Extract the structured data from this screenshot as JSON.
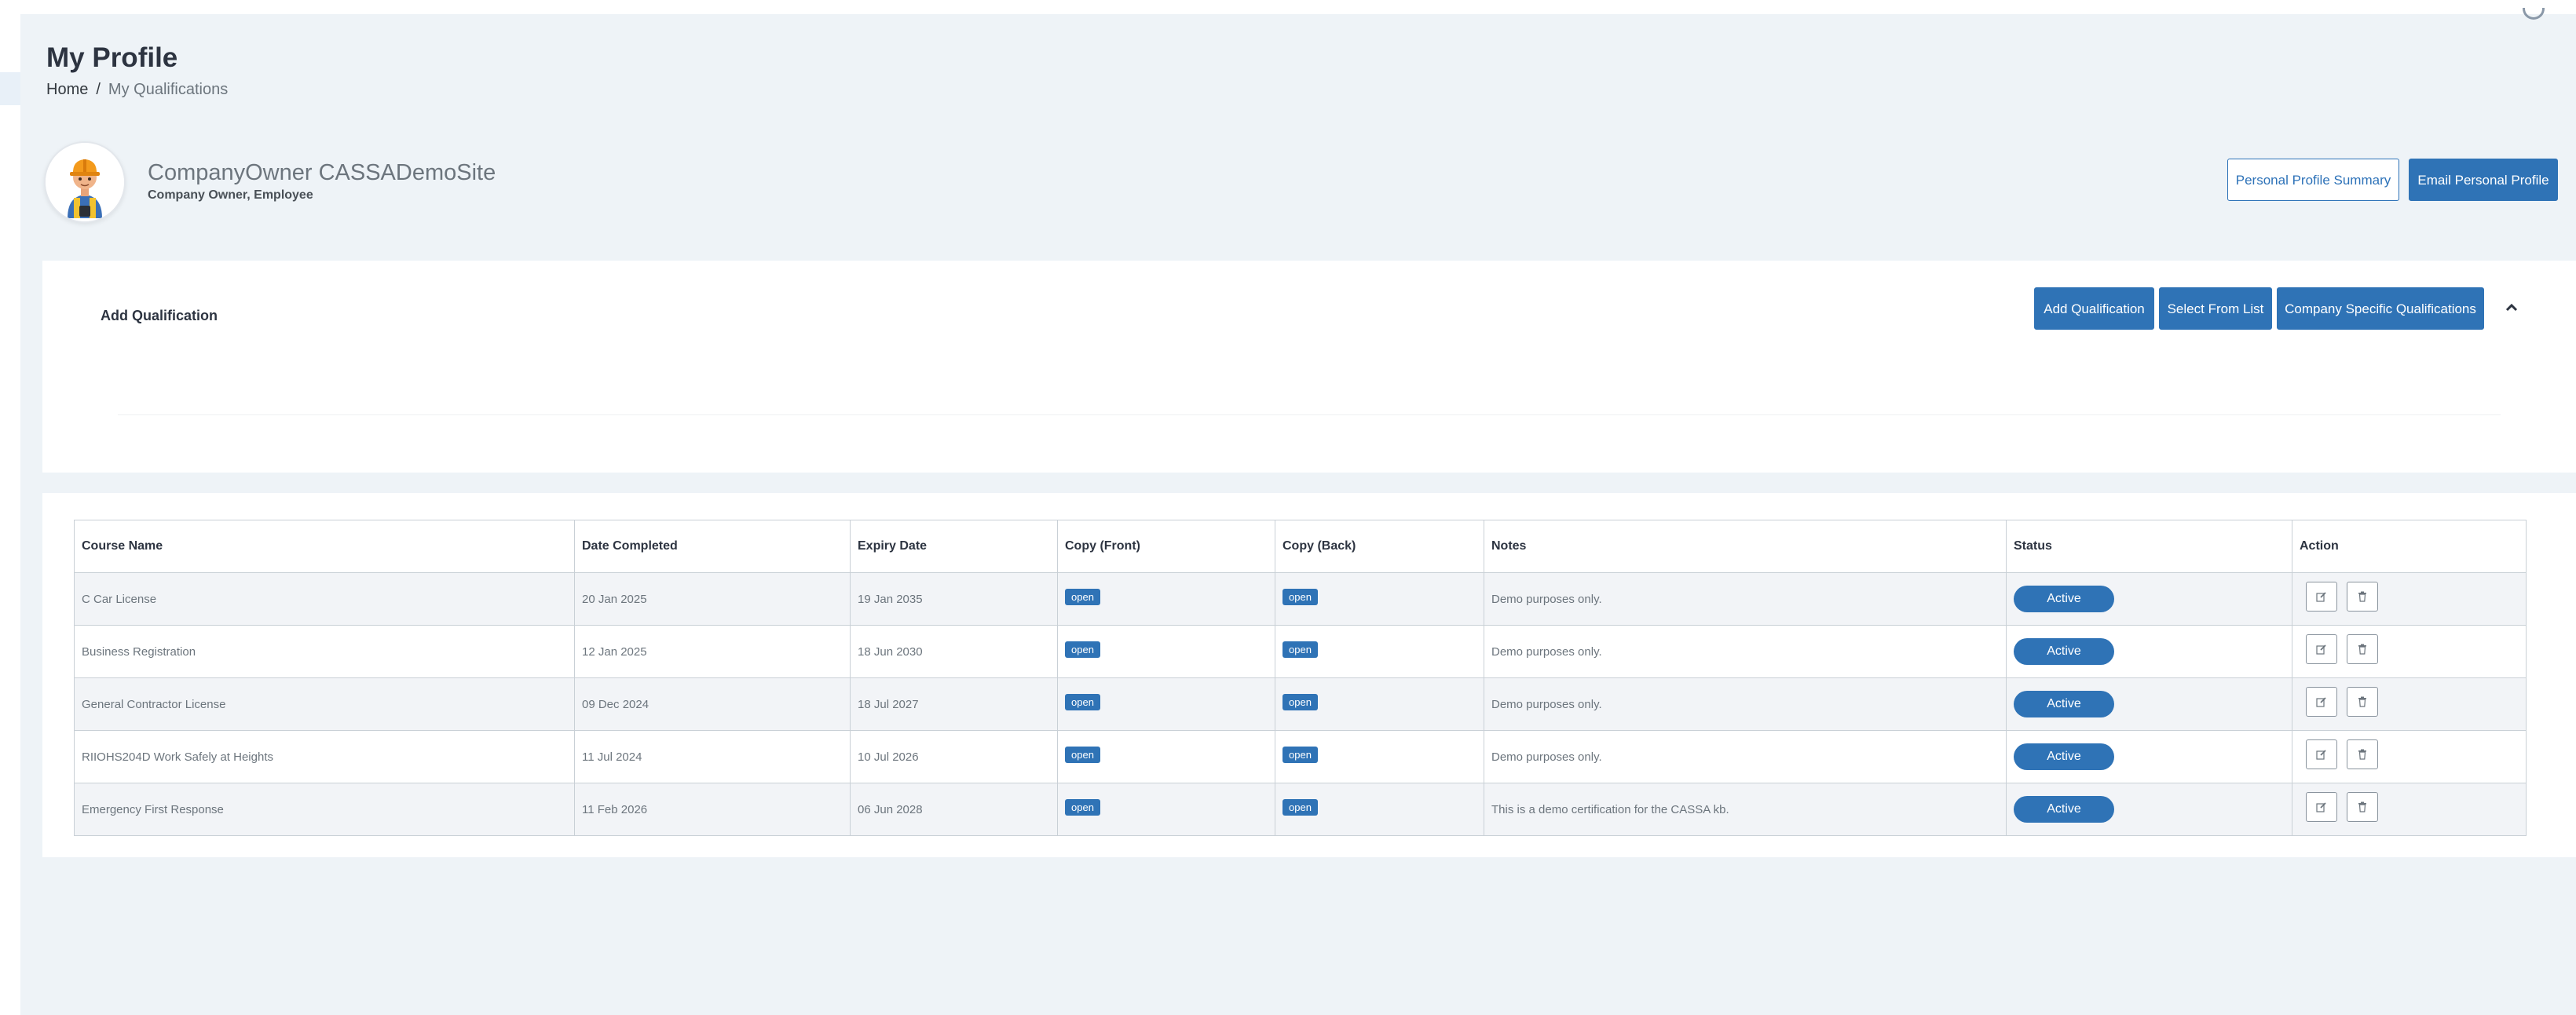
{
  "header": {
    "title": "My Profile",
    "breadcrumb": [
      "Home",
      "My Qualifications"
    ]
  },
  "profile": {
    "name": "CompanyOwner CASSADemoSite",
    "roles": "Company Owner, Employee",
    "summary_button": "Personal Profile Summary",
    "email_button": "Email Personal Profile"
  },
  "add_section": {
    "title": "Add Qualification",
    "add_button": "Add Qualification",
    "select_button": "Select From List",
    "company_button": "Company Specific Qualifications",
    "collapse_icon": "chevron-up-icon"
  },
  "table": {
    "columns": [
      "Course Name",
      "Date Completed",
      "Expiry Date",
      "Copy (Front)",
      "Copy (Back)",
      "Notes",
      "Status",
      "Action"
    ],
    "rows": [
      {
        "course": "C Car License",
        "completed": "20 Jan 2025",
        "expiry": "19 Jan 2035",
        "front": "open",
        "back": "open",
        "notes": "Demo purposes only.",
        "status": "Active"
      },
      {
        "course": "Business Registration",
        "completed": "12 Jan 2025",
        "expiry": "18 Jun 2030",
        "front": "open",
        "back": "open",
        "notes": "Demo purposes only.",
        "status": "Active"
      },
      {
        "course": "General Contractor License",
        "completed": "09 Dec 2024",
        "expiry": "18 Jul 2027",
        "front": "open",
        "back": "open",
        "notes": "Demo purposes only.",
        "status": "Active"
      },
      {
        "course": "RIIOHS204D Work Safely at Heights",
        "completed": "11 Jul 2024",
        "expiry": "10 Jul 2026",
        "front": "open",
        "back": "open",
        "notes": "Demo purposes only.",
        "status": "Active"
      },
      {
        "course": "Emergency First Response",
        "completed": "11 Feb 2026",
        "expiry": "06 Jun 2028",
        "front": "open",
        "back": "open",
        "notes": "This is a demo certification for the CASSA kb.",
        "status": "Active"
      }
    ]
  },
  "colors": {
    "primary": "#2f73b6",
    "page_background": "#eef3f7",
    "striped_row": "#f2f4f7"
  }
}
